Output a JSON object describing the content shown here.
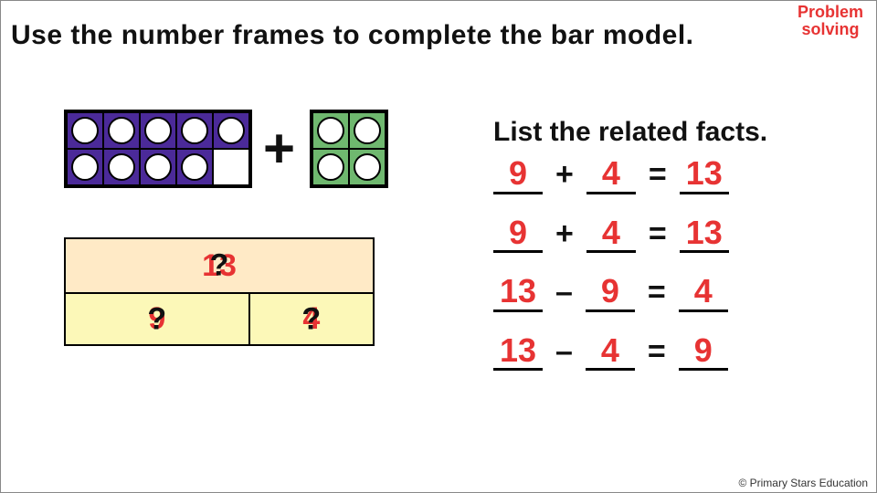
{
  "corner_label": "Problem solving",
  "title": "Use the number frames to complete the bar model.",
  "frames": {
    "left_count": 9,
    "right_count": 4,
    "operator": "+"
  },
  "bar_model": {
    "top_value": "13",
    "top_placeholder": "?",
    "left_value": "9",
    "left_placeholder": "?",
    "right_value": "4",
    "right_placeholder": "?"
  },
  "facts_title": "List the related facts.",
  "facts": [
    {
      "a": "9",
      "op": "+",
      "b": "4",
      "eq": "=",
      "c": "13"
    },
    {
      "a": "9",
      "op": "+",
      "b": "4",
      "eq": "=",
      "c": "13"
    },
    {
      "a": "13",
      "op": "–",
      "b": "9",
      "eq": "=",
      "c": "4"
    },
    {
      "a": "13",
      "op": "–",
      "b": "4",
      "eq": "=",
      "c": "9"
    }
  ],
  "copyright": "© Primary Stars Education"
}
